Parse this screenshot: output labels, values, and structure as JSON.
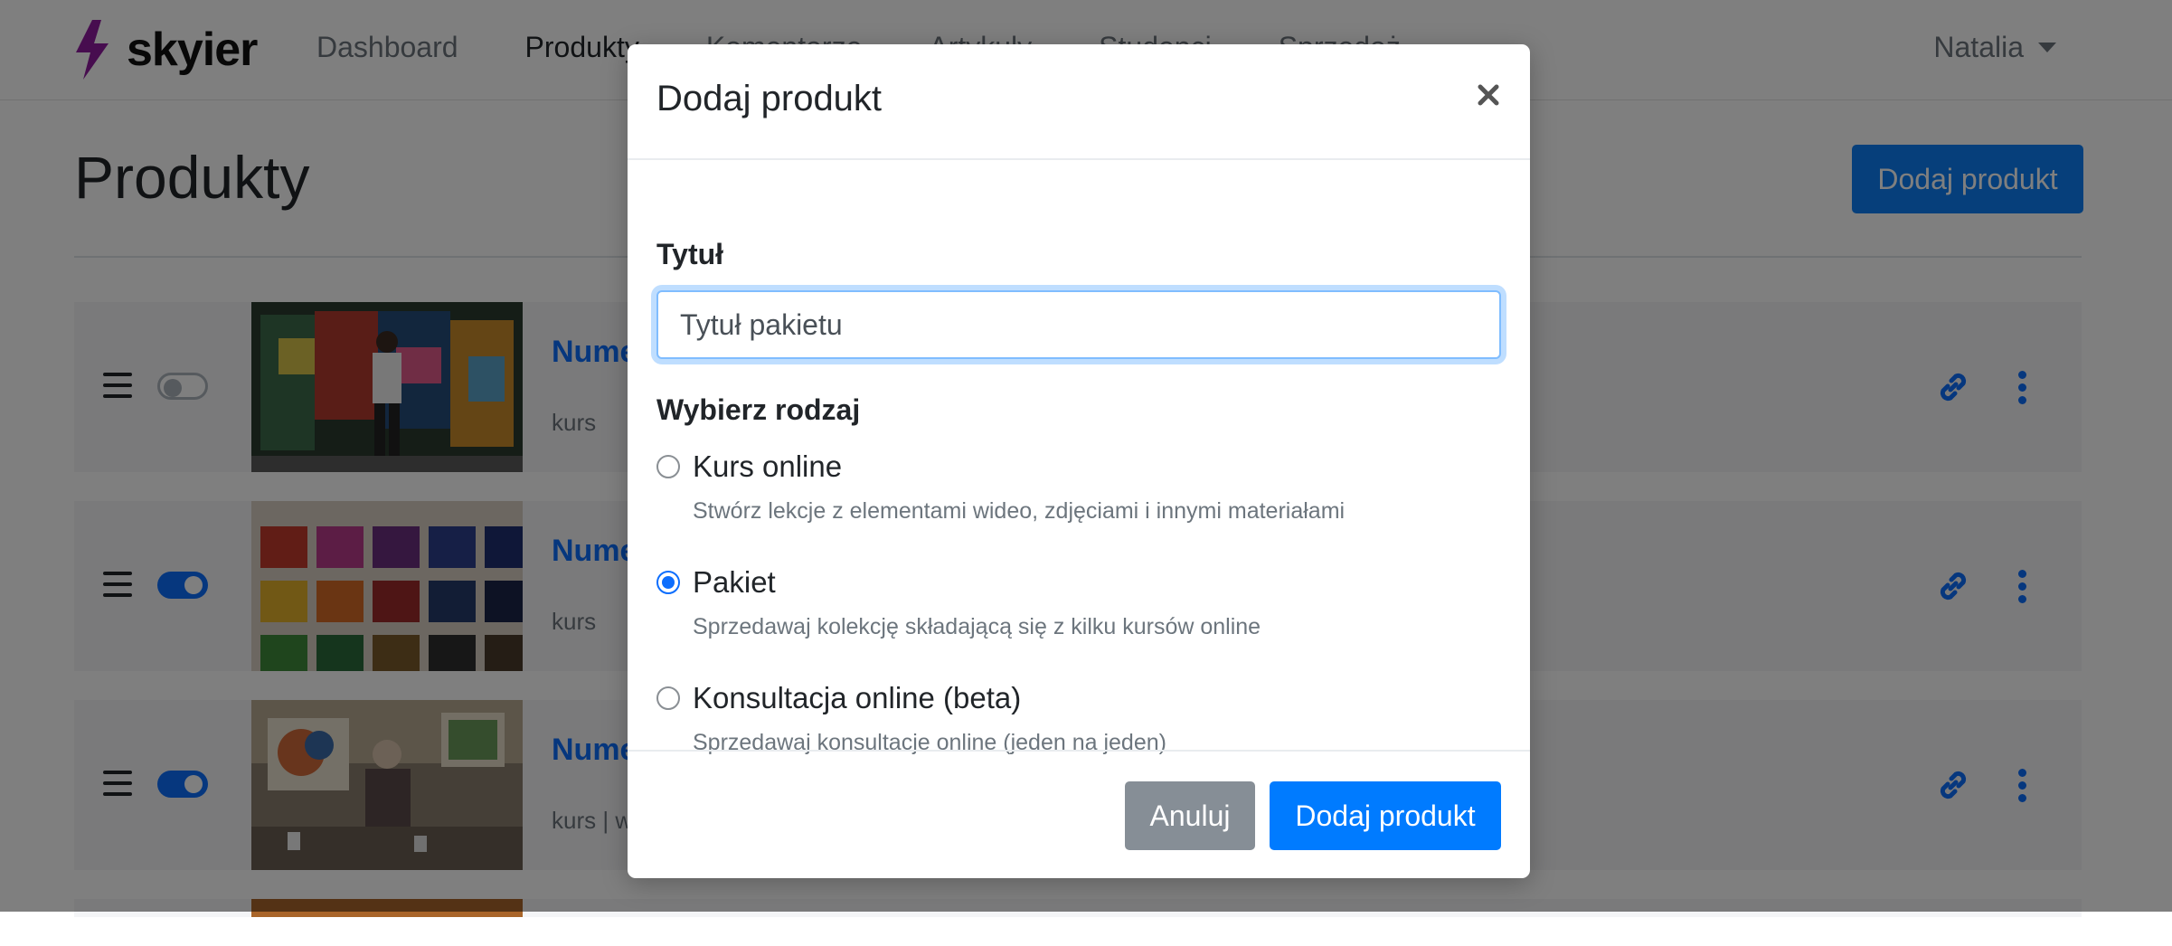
{
  "app": {
    "brand": "skyier"
  },
  "nav": {
    "links": [
      "Dashboard",
      "Produkty",
      "Komentarze",
      "Artykuły",
      "Studenci",
      "Sprzedaż"
    ],
    "user": "Natalia"
  },
  "page": {
    "title": "Produkty",
    "add_button": "Dodaj produkt"
  },
  "products": [
    {
      "title": "Nume",
      "meta": "kurs",
      "published": false,
      "icon": "link-icon"
    },
    {
      "title": "Nume",
      "meta": "kurs",
      "published": true,
      "icon": "link-icon"
    },
    {
      "title": "Nume",
      "meta": "kurs | w",
      "published": true,
      "icon": "link-icon"
    }
  ],
  "modal": {
    "title": "Dodaj produkt",
    "title_label": "Tytuł",
    "title_value": "Tytuł pakietu",
    "type_label": "Wybierz rodzaj",
    "options": [
      {
        "label": "Kurs online",
        "description": "Stwórz lekcje z elementami wideo, zdjęciami i innymi materiałami",
        "selected": false
      },
      {
        "label": "Pakiet",
        "description": "Sprzedawaj kolekcję składającą się z kilku kursów online",
        "selected": true
      },
      {
        "label": "Konsultacja online (beta)",
        "description": "Sprzedawaj konsultacje online (jeden na jeden)",
        "selected": false
      }
    ],
    "cancel": "Anuluj",
    "submit": "Dodaj produkt"
  },
  "colors": {
    "primary": "#007bff",
    "secondary": "#868e96",
    "brand_accent": "#8e1a9e"
  }
}
